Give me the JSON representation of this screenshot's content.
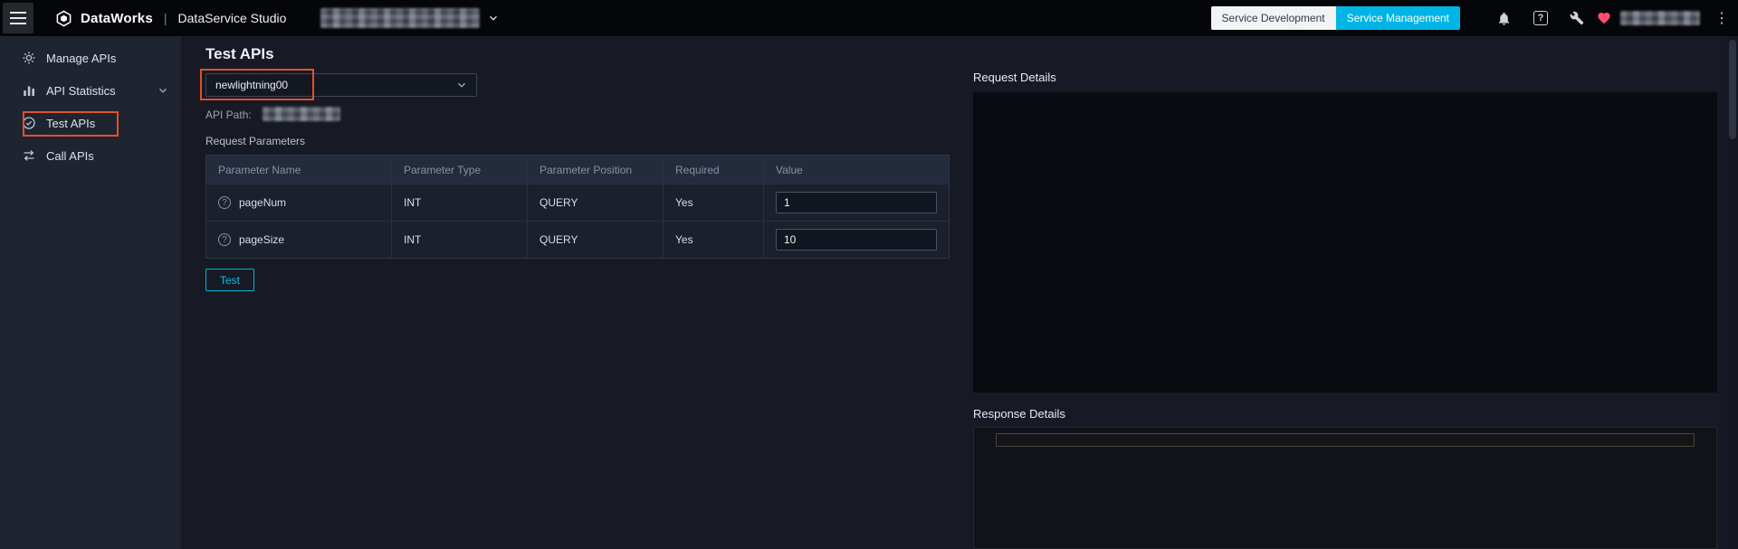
{
  "colors": {
    "accent_cyan": "#00b5e6",
    "annotation_orange": "#e0512d",
    "heart_red": "#ff4d6d",
    "topbar_bg": "#05060a",
    "sidebar_bg": "#1f2431",
    "main_bg": "#171a24"
  },
  "topbar": {
    "brand": "DataWorks",
    "separator": "|",
    "product": "DataService Studio",
    "tabs": [
      {
        "label": "Service Development",
        "active": false
      },
      {
        "label": "Service Management",
        "active": true
      }
    ],
    "help_glyph": "?",
    "more_glyph": "⋮"
  },
  "sidebar": {
    "items": [
      {
        "label": "Manage APIs"
      },
      {
        "label": "API Statistics"
      },
      {
        "label": "Test APIs"
      },
      {
        "label": "Call APIs"
      }
    ]
  },
  "main": {
    "title": "Test APIs",
    "api_select": {
      "value": "newlightning00"
    },
    "api_path_label": "API Path:",
    "request_parameters_label": "Request Parameters",
    "table": {
      "headers": [
        "Parameter Name",
        "Parameter Type",
        "Parameter Position",
        "Required",
        "Value"
      ],
      "help_glyph": "?",
      "rows": [
        {
          "name": "pageNum",
          "type": "INT",
          "position": "QUERY",
          "required": "Yes",
          "value": "1"
        },
        {
          "name": "pageSize",
          "type": "INT",
          "position": "QUERY",
          "required": "Yes",
          "value": "10"
        }
      ]
    },
    "test_button_label": "Test"
  },
  "right_panel": {
    "request_details_label": "Request Details",
    "response_details_label": "Response Details"
  }
}
